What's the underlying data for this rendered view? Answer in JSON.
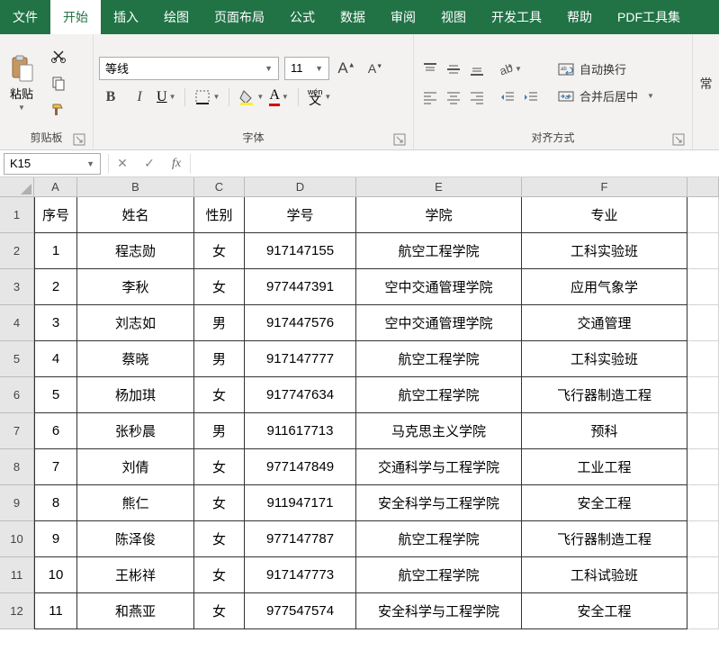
{
  "tabs": [
    "文件",
    "开始",
    "插入",
    "绘图",
    "页面布局",
    "公式",
    "数据",
    "审阅",
    "视图",
    "开发工具",
    "帮助",
    "PDF工具集"
  ],
  "active_tab_index": 1,
  "ribbon": {
    "clipboard": {
      "paste": "粘贴",
      "label": "剪贴板"
    },
    "font": {
      "name": "等线",
      "size": "11",
      "label": "字体",
      "bold": "B",
      "italic": "I",
      "underline": "U",
      "increase": "A",
      "decrease": "A",
      "wen": "wén"
    },
    "align": {
      "label": "对齐方式",
      "wrap": "自动换行",
      "merge": "合并后居中"
    },
    "more": "常"
  },
  "formula_bar": {
    "name_box": "K15",
    "fx": "fx"
  },
  "columns": [
    "A",
    "B",
    "C",
    "D",
    "E",
    "F"
  ],
  "headers": {
    "a": "序号",
    "b": "姓名",
    "c": "性别",
    "d": "学号",
    "e": "学院",
    "f": "专业"
  },
  "rows": [
    {
      "n": "1",
      "a": "1",
      "b": "程志勋",
      "c": "女",
      "d": "917147155",
      "e": "航空工程学院",
      "f": "工科实验班"
    },
    {
      "n": "2",
      "a": "2",
      "b": "李秋",
      "c": "女",
      "d": "977447391",
      "e": "空中交通管理学院",
      "f": "应用气象学"
    },
    {
      "n": "3",
      "a": "3",
      "b": "刘志如",
      "c": "男",
      "d": "917447576",
      "e": "空中交通管理学院",
      "f": "交通管理"
    },
    {
      "n": "4",
      "a": "4",
      "b": "蔡晓",
      "c": "男",
      "d": "917147777",
      "e": "航空工程学院",
      "f": "工科实验班"
    },
    {
      "n": "5",
      "a": "5",
      "b": "杨加琪",
      "c": "女",
      "d": "917747634",
      "e": "航空工程学院",
      "f": "飞行器制造工程"
    },
    {
      "n": "6",
      "a": "6",
      "b": "张秒晨",
      "c": "男",
      "d": "911617713",
      "e": "马克思主义学院",
      "f": "预科"
    },
    {
      "n": "7",
      "a": "7",
      "b": "刘倩",
      "c": "女",
      "d": "977147849",
      "e": "交通科学与工程学院",
      "f": "工业工程"
    },
    {
      "n": "8",
      "a": "8",
      "b": "熊仁",
      "c": "女",
      "d": "911947171",
      "e": "安全科学与工程学院",
      "f": "安全工程"
    },
    {
      "n": "9",
      "a": "9",
      "b": "陈泽俊",
      "c": "女",
      "d": "977147787",
      "e": "航空工程学院",
      "f": "飞行器制造工程"
    },
    {
      "n": "10",
      "a": "10",
      "b": "王彬祥",
      "c": "女",
      "d": "917147773",
      "e": "航空工程学院",
      "f": "工科试验班"
    },
    {
      "n": "11",
      "a": "11",
      "b": "和燕亚",
      "c": "女",
      "d": "977547574",
      "e": "安全科学与工程学院",
      "f": "安全工程"
    }
  ]
}
